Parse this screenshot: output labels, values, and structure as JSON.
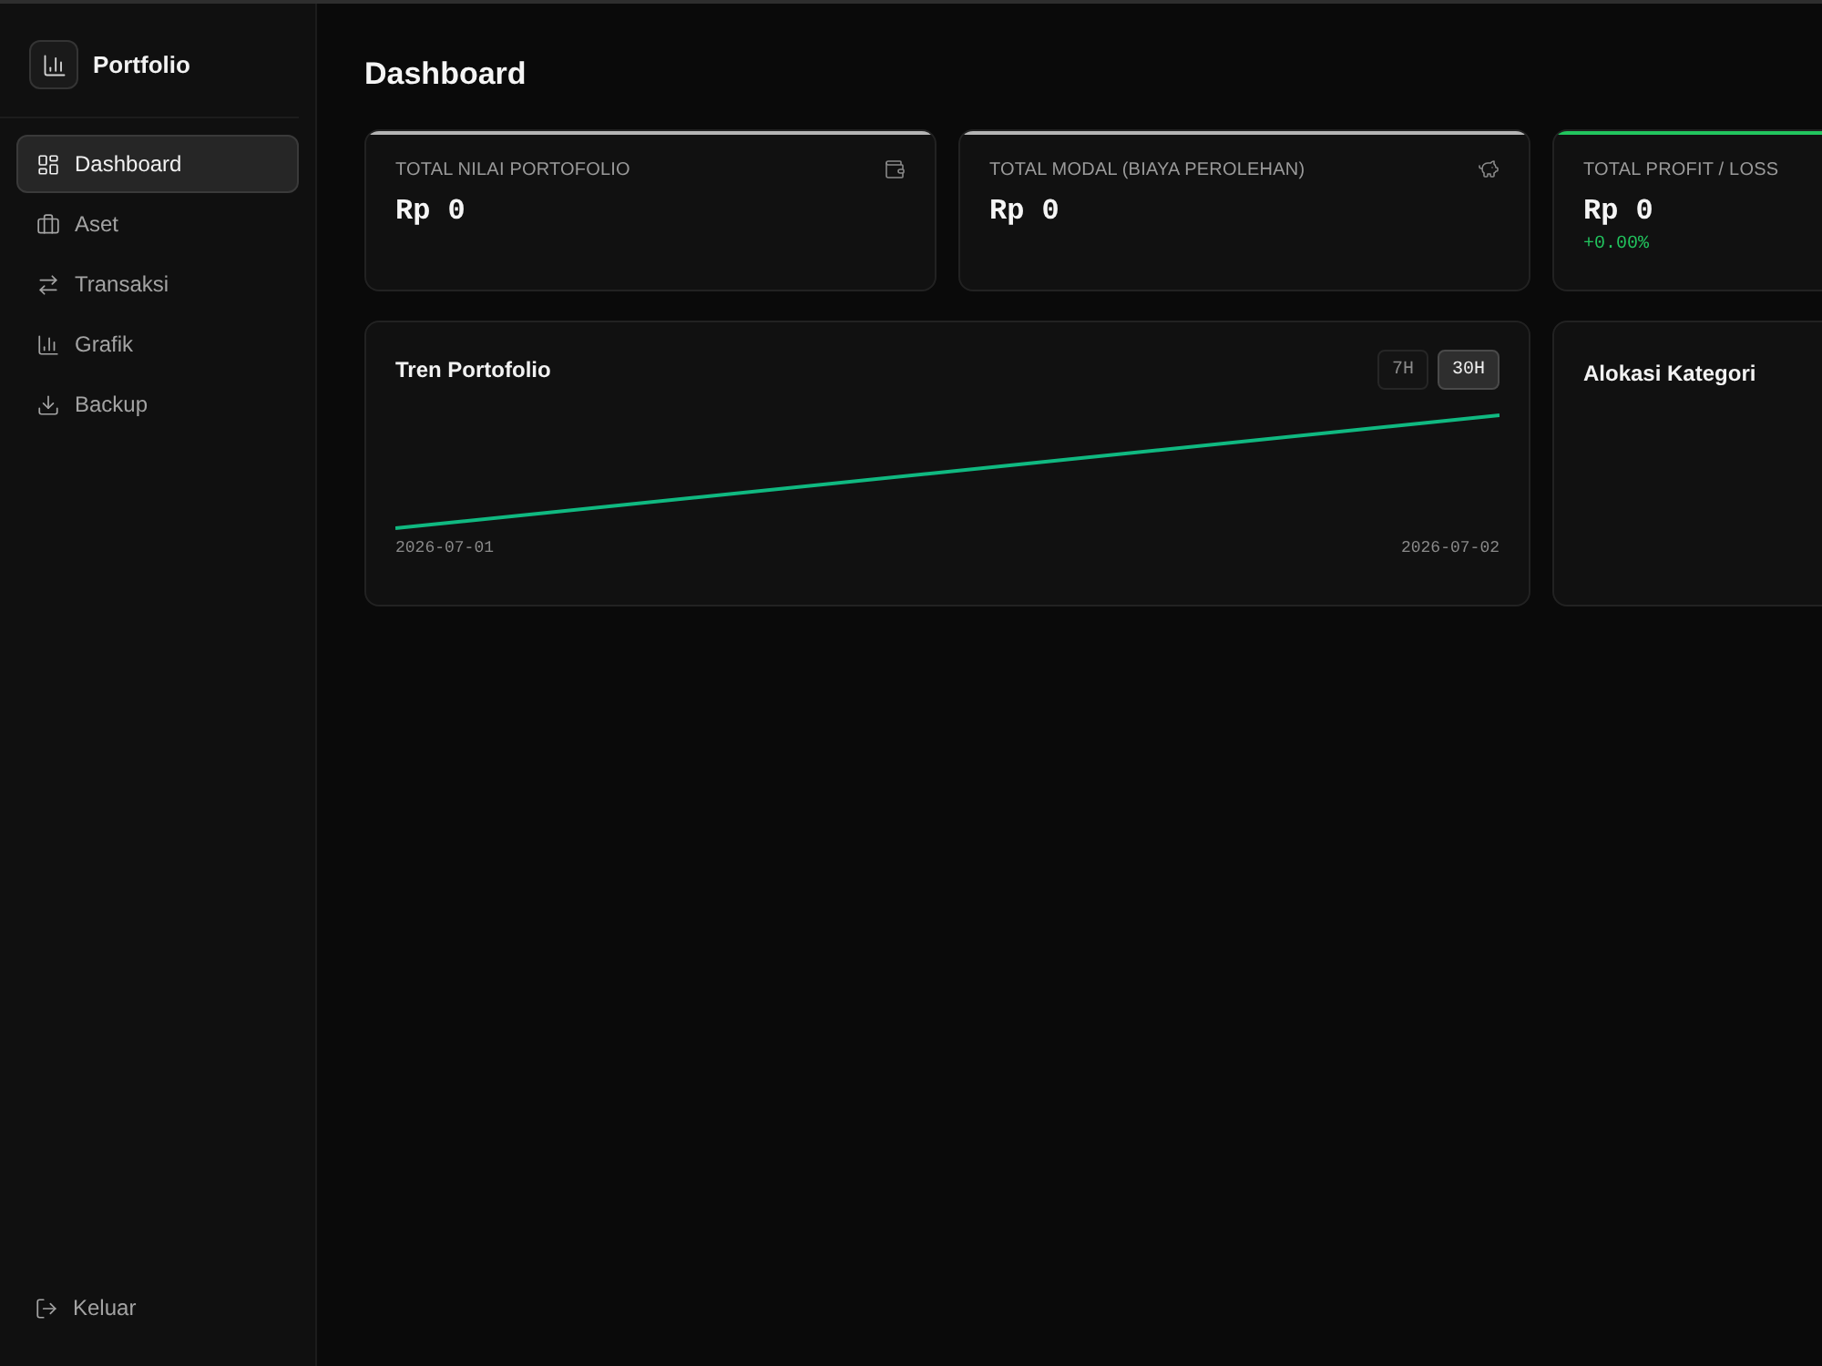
{
  "sidebar": {
    "brand": "Portfolio",
    "items": [
      {
        "label": "Dashboard",
        "selected": true
      },
      {
        "label": "Aset",
        "selected": false
      },
      {
        "label": "Transaksi",
        "selected": false
      },
      {
        "label": "Grafik",
        "selected": false
      },
      {
        "label": "Backup",
        "selected": false
      }
    ],
    "footer_item": {
      "label": "Keluar"
    }
  },
  "main": {
    "title": "Dashboard",
    "stat_cards": [
      {
        "label": "TOTAL NILAI PORTOFOLIO",
        "value": "Rp 0",
        "color": "#b5b5b5"
      },
      {
        "label": "TOTAL MODAL (BIAYA PEROLEHAN)",
        "value": "Rp 0",
        "color": "#b5b5b5"
      },
      {
        "label": "TOTAL PROFIT / LOSS",
        "value": "Rp 0",
        "change": "+0.00%",
        "color": "#22c55e"
      }
    ],
    "trend_panel": {
      "title": "Tren Portofolio",
      "ranges": [
        {
          "label": "7H",
          "selected": false
        },
        {
          "label": "30H",
          "selected": true
        }
      ],
      "x_labels": [
        "2026-07-01",
        "2026-07-02"
      ]
    },
    "allocation_panel": {
      "title": "Alokasi Kategori"
    }
  }
}
